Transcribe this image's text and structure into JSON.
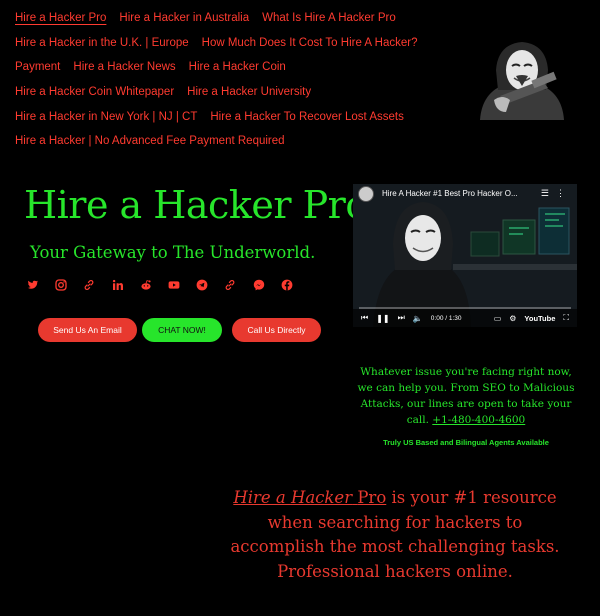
{
  "nav": {
    "rows": [
      [
        "Hire a Hacker Pro",
        "Hire a Hacker in Australia",
        "What Is Hire A Hacker Pro"
      ],
      [
        "Hire a Hacker in the U.K. | Europe",
        "How Much Does It Cost To Hire A Hacker?"
      ],
      [
        "Payment",
        "Hire a Hacker News",
        "Hire a Hacker Coin"
      ],
      [
        "Hire a Hacker Coin Whitepaper",
        "Hire a Hacker University"
      ],
      [
        "Hire a Hacker in New York | NJ | CT",
        "Hire a Hacker To Recover Lost Assets"
      ],
      [
        "Hire a Hacker | No Advanced Fee Payment Required"
      ]
    ],
    "active": "Hire a Hacker Pro"
  },
  "hero": {
    "title": "Hire a Hacker Pro",
    "subtitle": "Your Gateway to The Underworld."
  },
  "social_icons": [
    "twitter-icon",
    "instagram-icon",
    "link-icon",
    "linkedin-icon",
    "reddit-icon",
    "youtube-icon",
    "telegram-icon",
    "link-icon",
    "messenger-icon",
    "facebook-icon"
  ],
  "buttons": {
    "email": "Send Us An Email",
    "chat": "CHAT NOW!",
    "call": "Call Us Directly"
  },
  "video": {
    "title": "Hire A Hacker #1 Best Pro Hacker O...",
    "time": "0:00 / 1:30",
    "progress": 0,
    "logo": "YouTube"
  },
  "info": {
    "text": "Whatever issue you're facing right now, we can help you. From SEO to Malicious Attacks, our lines are open to take your call.",
    "phone": "+1-480-400-4600"
  },
  "agents": "Truly US Based and Bilingual Agents Available",
  "tagline": {
    "brand": "Hire a Hacker",
    "brand_suffix": "Pro",
    "text": "is your #1 resource when searching for hackers to accomplish the most challenging tasks. Professional hackers online."
  },
  "colors": {
    "background": "#000000",
    "green": "#27e52b",
    "red": "#e8392f",
    "nav_red": "#ff3b30"
  }
}
